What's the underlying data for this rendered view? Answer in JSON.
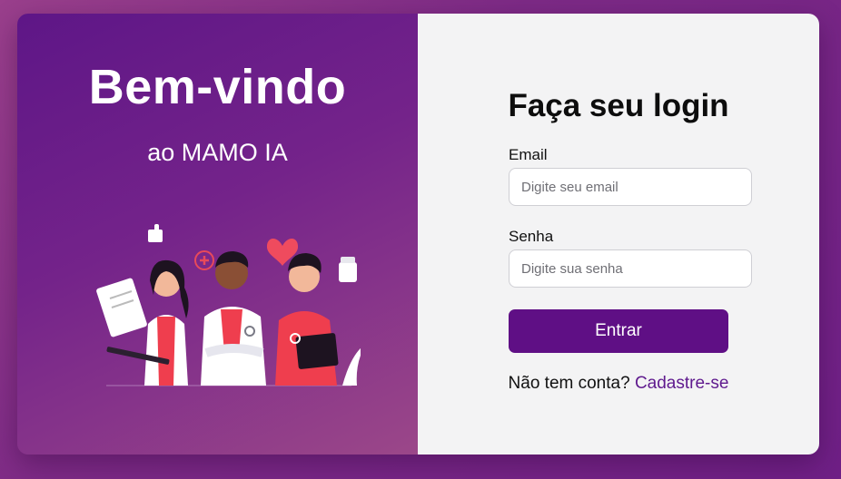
{
  "welcome": {
    "title": "Bem-vindo",
    "subtitle": "ao MAMO IA",
    "illustration": "medical-team-illustration"
  },
  "login": {
    "title": "Faça seu login",
    "email_label": "Email",
    "email_placeholder": "Digite seu email",
    "email_value": "",
    "password_label": "Senha",
    "password_placeholder": "Digite sua senha",
    "password_value": "",
    "submit_label": "Entrar",
    "no_account_text": "Não tem conta?",
    "signup_link": "Cadastre-se"
  },
  "colors": {
    "primary": "#5f0f85",
    "link": "#5f1a8e",
    "panel_light": "#f3f3f4"
  }
}
